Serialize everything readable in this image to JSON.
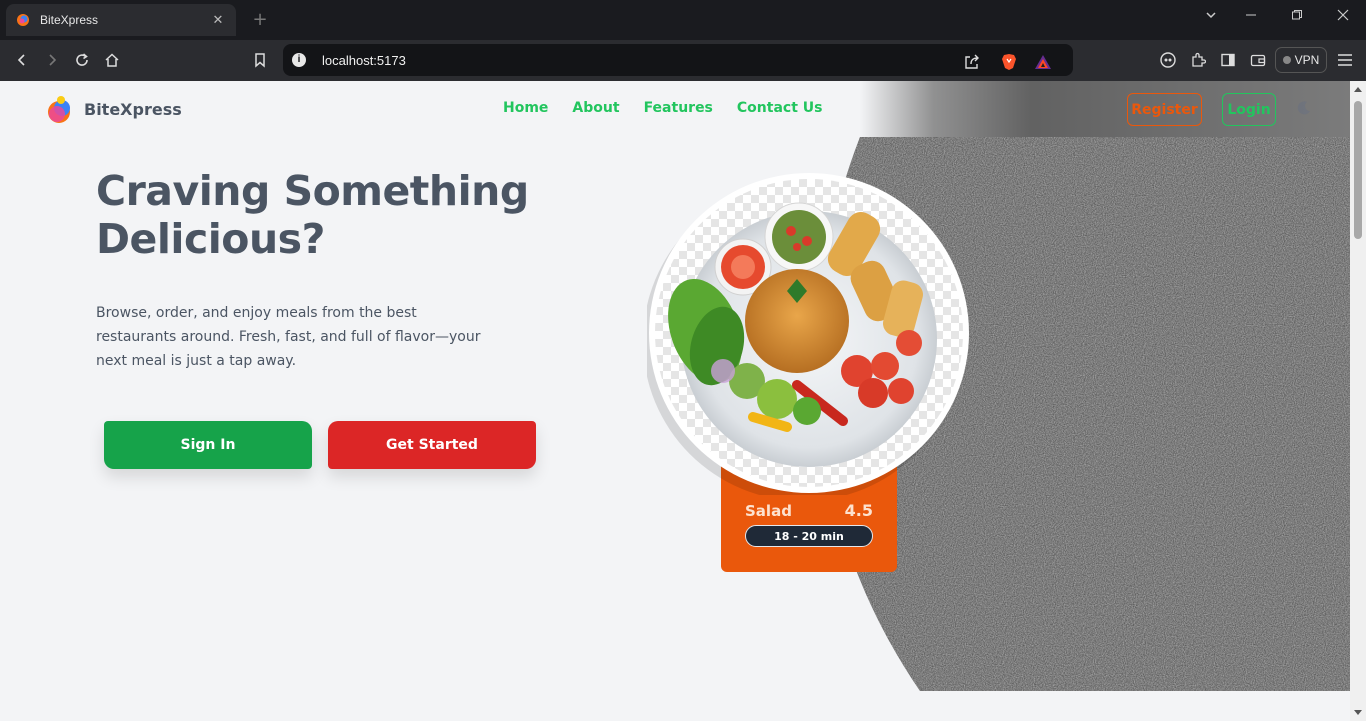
{
  "browser": {
    "tab_title": "BiteXpress",
    "url": "localhost:5173",
    "vpn_label": "VPN",
    "new_tab_glyph": "+",
    "tab_close_glyph": "✕"
  },
  "header": {
    "brand_name": "BiteXpress",
    "nav": [
      "Home",
      "About",
      "Features",
      "Contact Us"
    ],
    "register_label": "Register",
    "login_label": "Login"
  },
  "hero": {
    "title": "Craving Something Delicious?",
    "description": "Browse, order, and enjoy meals from the best restaurants around. Fresh, fast, and full of flavor—your next meal is just a tap away.",
    "signin_label": "Sign In",
    "get_started_label": "Get Started"
  },
  "food_card": {
    "name": "Salad",
    "rating": "4.5",
    "delivery_time": "18 - 20 min"
  },
  "colors": {
    "primary_green": "#22c55e",
    "button_green": "#16a34a",
    "button_red": "#dc2626",
    "orange": "#ea580c",
    "text_gray": "#4b5563",
    "background": "#f3f4f6"
  },
  "icons": [
    "back-icon",
    "forward-icon",
    "reload-icon",
    "home-icon",
    "bookmark-icon",
    "share-icon",
    "brave-shield-icon",
    "brave-rewards-icon",
    "extensions-icon",
    "sidebar-icon",
    "wallet-icon",
    "menu-icon",
    "moon-icon"
  ]
}
